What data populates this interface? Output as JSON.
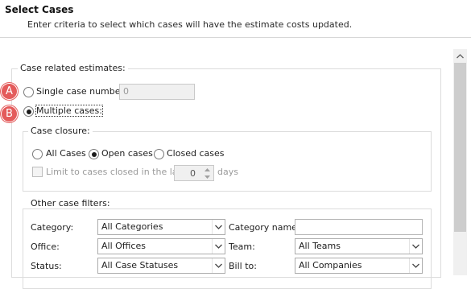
{
  "header": {
    "title": "Select Cases",
    "subtitle": "Enter criteria to select which cases will have the estimate costs updated."
  },
  "case_estimates": {
    "legend": "Case related estimates:",
    "single_case": {
      "label": "Single case number:",
      "value": "0",
      "badge": "A",
      "selected": false
    },
    "multiple_cases": {
      "label": "Multiple cases:",
      "badge": "B",
      "selected": true
    }
  },
  "case_closure": {
    "legend": "Case closure:",
    "options": [
      {
        "label": "All Cases",
        "selected": false
      },
      {
        "label": "Open cases",
        "selected": true
      },
      {
        "label": "Closed cases",
        "selected": false
      }
    ],
    "limit": {
      "label": "Limit to cases closed in the last:",
      "value": "0",
      "unit": "days",
      "checked": false
    }
  },
  "other_filters": {
    "legend": "Other case filters:",
    "category": {
      "label": "Category:",
      "value": "All Categories"
    },
    "category_name": {
      "label": "Category name:",
      "value": ""
    },
    "office": {
      "label": "Office:",
      "value": "All Offices"
    },
    "team": {
      "label": "Team:",
      "value": "All Teams"
    },
    "status": {
      "label": "Status:",
      "value": "All Case Statuses"
    },
    "bill_to": {
      "label": "Bill to:",
      "value": "All Companies"
    }
  },
  "icons": {
    "dropdown": "chevron-down-icon",
    "spin_up": "spin-up-icon",
    "spin_down": "spin-down-icon",
    "scroll_up": "scroll-up-arrow-icon"
  },
  "colors": {
    "badge": "#e45b5b",
    "group_border": "#dcdcdc"
  }
}
